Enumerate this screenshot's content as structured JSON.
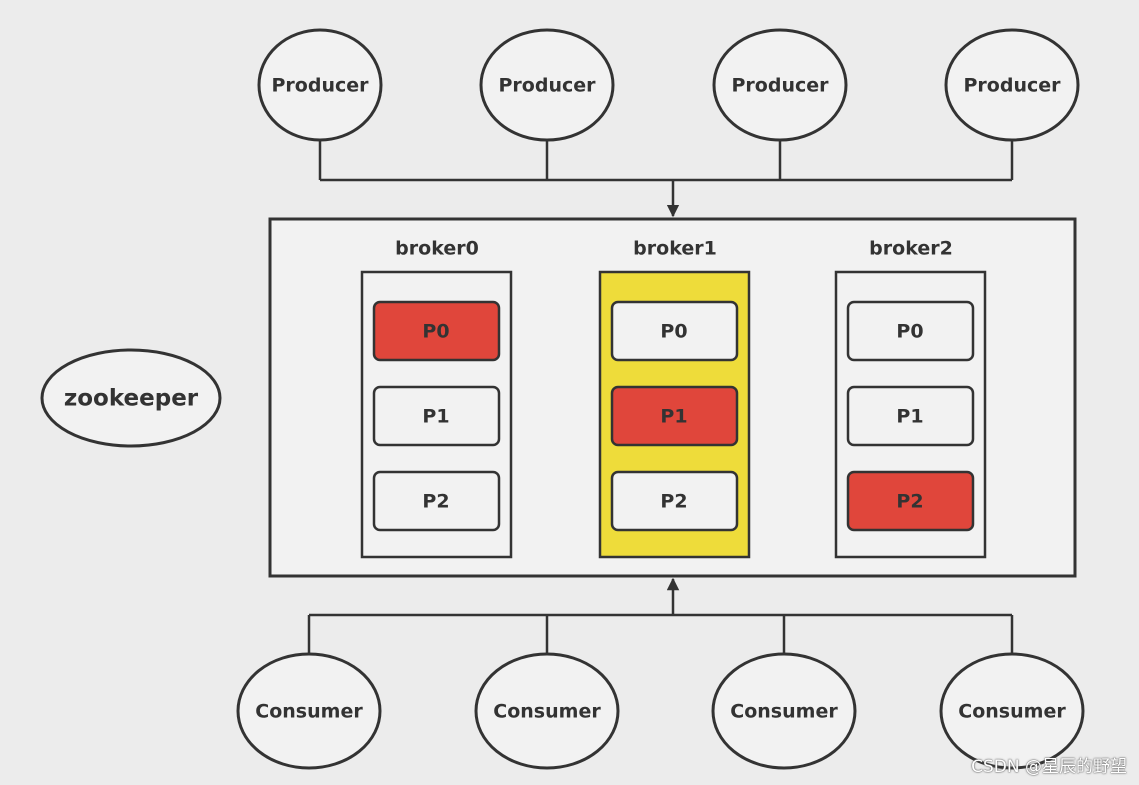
{
  "producers": [
    "Producer",
    "Producer",
    "Producer",
    "Producer"
  ],
  "consumers": [
    "Consumer",
    "Consumer",
    "Consumer",
    "Consumer"
  ],
  "zookeeper": "zookeeper",
  "brokers": [
    {
      "name": "broker0",
      "highlighted": false,
      "partitions": [
        {
          "label": "P0",
          "leader": true
        },
        {
          "label": "P1",
          "leader": false
        },
        {
          "label": "P2",
          "leader": false
        }
      ]
    },
    {
      "name": "broker1",
      "highlighted": true,
      "partitions": [
        {
          "label": "P0",
          "leader": false
        },
        {
          "label": "P1",
          "leader": true
        },
        {
          "label": "P2",
          "leader": false
        }
      ]
    },
    {
      "name": "broker2",
      "highlighted": false,
      "partitions": [
        {
          "label": "P0",
          "leader": false
        },
        {
          "label": "P1",
          "leader": false
        },
        {
          "label": "P2",
          "leader": true
        }
      ]
    }
  ],
  "colors": {
    "leader": "#e0463b",
    "highlight": "#eedc3a",
    "node": "#f2f2f2",
    "background": "#ececec"
  },
  "watermark": "CSDN @星辰的野望"
}
